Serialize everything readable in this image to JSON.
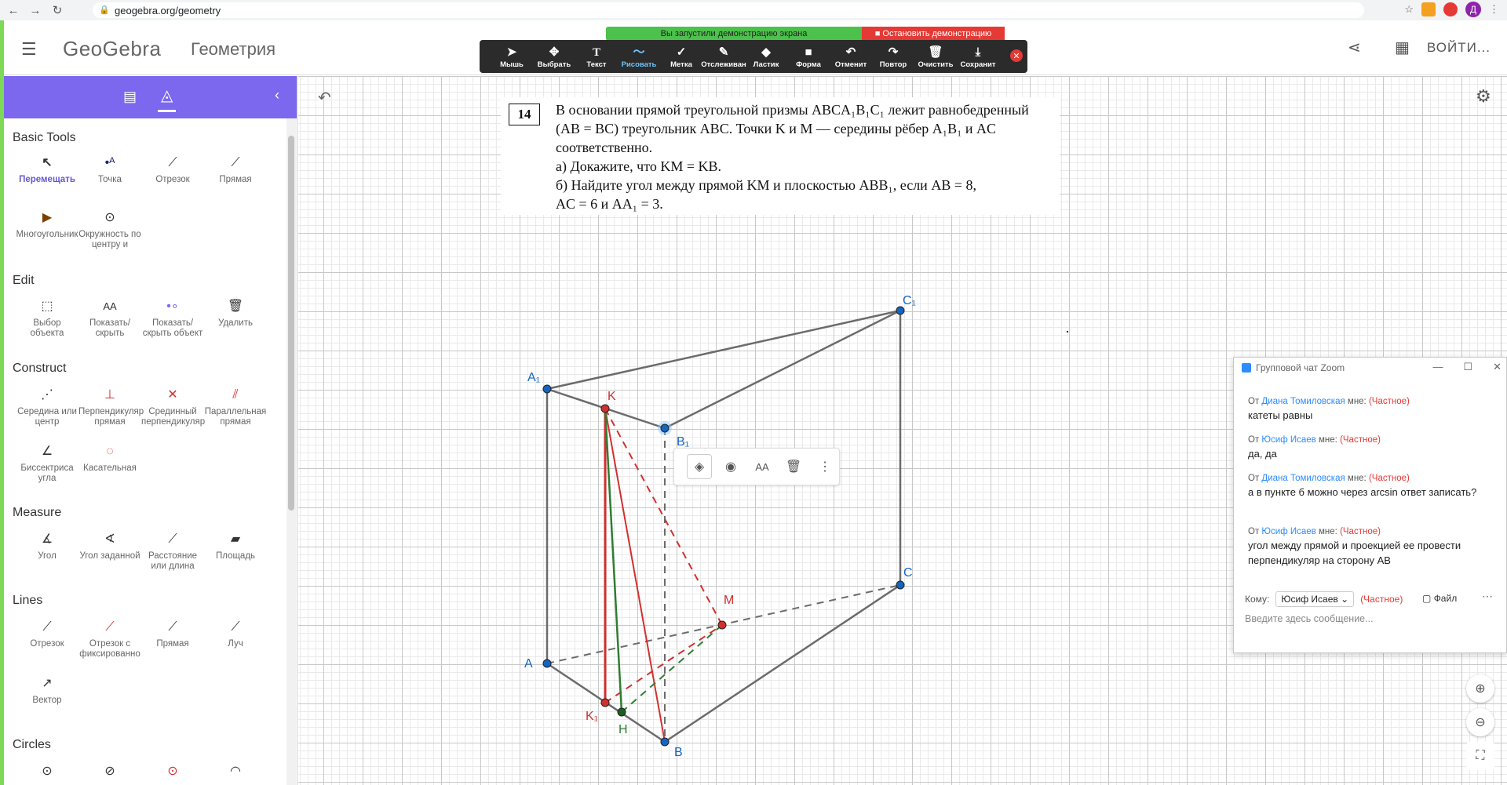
{
  "browser": {
    "url": "geogebra.org/geometry",
    "profile_initial": "Д"
  },
  "header": {
    "logo": "GeoGebra",
    "title": "Геометрия",
    "login": "ВОЙТИ..."
  },
  "zoom_banner": {
    "sharing_text": "Вы запустили демонстрацию экрана",
    "stop_label": "Остановить демонстрацию"
  },
  "toolbar": {
    "items": [
      {
        "label": "Мышь",
        "icon": "mouse-pointer-icon"
      },
      {
        "label": "Выбрать",
        "icon": "move-icon"
      },
      {
        "label": "Текст",
        "icon": "text-icon"
      },
      {
        "label": "Рисовать",
        "icon": "draw-icon"
      },
      {
        "label": "Метка",
        "icon": "check-mark-icon"
      },
      {
        "label": "Отслеживан",
        "icon": "spotlight-icon"
      },
      {
        "label": "Ластик",
        "icon": "eraser-icon"
      },
      {
        "label": "Форма",
        "icon": "shape-icon"
      },
      {
        "label": "Отменит",
        "icon": "undo-icon"
      },
      {
        "label": "Повтор",
        "icon": "redo-icon"
      },
      {
        "label": "Очистить",
        "icon": "trash-icon"
      },
      {
        "label": "Сохранит",
        "icon": "save-icon"
      }
    ],
    "active": "Рисовать"
  },
  "sidebar": {
    "categories": {
      "basic": "Basic Tools",
      "edit": "Edit",
      "construct": "Construct",
      "measure": "Measure",
      "lines": "Lines",
      "circles": "Circles"
    },
    "basic": [
      "Перемещать",
      "Точка",
      "Отрезок",
      "Прямая",
      "Многоугольник",
      "Окружность по центру и"
    ],
    "edit": [
      "Выбор объекта",
      "Показать/ скрыть",
      "Показать/ скрыть объект",
      "Удалить"
    ],
    "construct": [
      "Середина или центр",
      "Перпендикуляр прямая",
      "Срединный перпендикуляр",
      "Параллельная прямая",
      "Биссектриса угла",
      "Касательная"
    ],
    "measure": [
      "Угол",
      "Угол заданной",
      "Расстояние или длина",
      "Площадь"
    ],
    "lines": [
      "Отрезок",
      "Отрезок с фиксированно",
      "Прямая",
      "Луч",
      "Вектор"
    ]
  },
  "problem": {
    "number": "14",
    "line1": "В основании прямой треугольной призмы ABCA₁B₁C₁ лежит равнобедренный",
    "line2": "(AB = BC) треугольник ABC. Точки K и M — середины рёбер A₁B₁ и AC",
    "line3": "соответственно.",
    "line4": "а) Докажите, что KM = KB.",
    "line5": "б) Найдите угол между прямой KM и плоскостью ABB₁, если AB = 8,",
    "line6": "AC = 6 и AA₁ = 3."
  },
  "figure": {
    "labels": {
      "A1": "A₁",
      "B1": "B₁",
      "C1": "C₁",
      "A": "A",
      "B": "B",
      "C": "C",
      "K": "K",
      "K1": "K₁",
      "M": "M",
      "H": "H"
    },
    "colors": {
      "edge": "#6b6b6b",
      "point_blue": "#1565c0",
      "point_red": "#d32f2f",
      "point_green": "#1b5e20",
      "red_line": "#d32f2f",
      "green_line": "#2e7d32",
      "label_blue": "#1565c0",
      "label_red": "#d32f2f",
      "label_green": "#2e7d32"
    }
  },
  "zoom_chat": {
    "title": "Групповой чат Zoom",
    "messages": [
      {
        "from": "Диана Томиловская",
        "to": "мне:",
        "private": "(Частное)",
        "text": "катеты равны"
      },
      {
        "from": "Юсиф Исаев",
        "to": "мне:",
        "private": "(Частное)",
        "text": "да, да"
      },
      {
        "from": "Диана Томиловская",
        "to": "мне:",
        "private": "(Частное)",
        "text": "а в пункте б можно через arcsin ответ записать?"
      },
      {
        "from": "Юсиф Исаев",
        "to": "мне:",
        "private": "(Частное)",
        "text": "угол между прямой и проекцией ее провести перпендикуляр на сторону АВ"
      }
    ],
    "from_prefix": "От",
    "to_label": "Кому:",
    "to_value": "Юсиф Исаев",
    "to_private": "(Частное)",
    "file_label": "Файл",
    "input_placeholder": "Введите здесь сообщение..."
  }
}
